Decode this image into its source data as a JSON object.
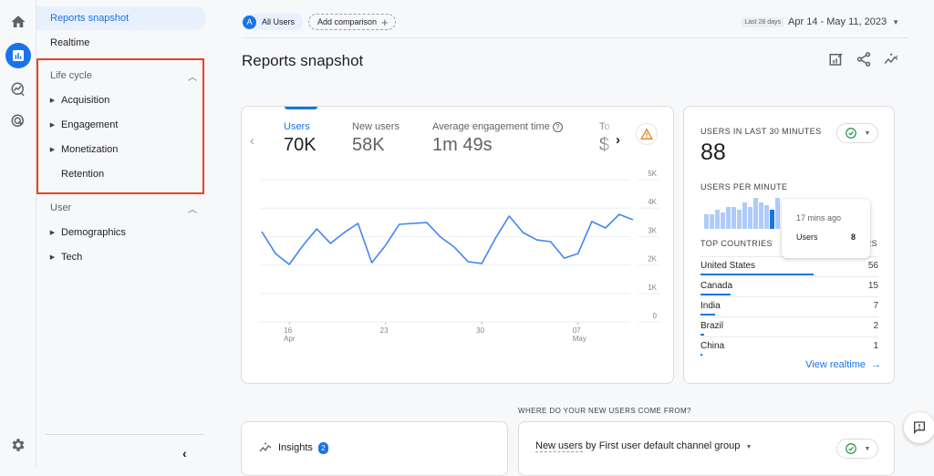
{
  "rail": {
    "icons": [
      "home-icon",
      "reports-icon",
      "explore-icon",
      "advertising-icon",
      "settings-icon"
    ],
    "active": "reports-icon"
  },
  "nav": {
    "reports_snapshot": "Reports snapshot",
    "realtime": "Realtime",
    "lifecycle": {
      "title": "Life cycle",
      "items": [
        {
          "label": "Acquisition",
          "expandable": true
        },
        {
          "label": "Engagement",
          "expandable": true
        },
        {
          "label": "Monetization",
          "expandable": true
        },
        {
          "label": "Retention",
          "expandable": false
        }
      ]
    },
    "user": {
      "title": "User",
      "items": [
        {
          "label": "Demographics",
          "expandable": true
        },
        {
          "label": "Tech",
          "expandable": true
        }
      ]
    },
    "collapse_glyph": "‹"
  },
  "header": {
    "segment_avatar": "A",
    "segment_label": "All Users",
    "add_comparison": "Add comparison",
    "date_badge": "Last 28 days",
    "date_range": "Apr 14 - May 11, 2023",
    "page_title": "Reports snapshot"
  },
  "metrics": [
    {
      "label": "Users",
      "value": "70K",
      "selected": true
    },
    {
      "label": "New users",
      "value": "58K",
      "selected": false
    },
    {
      "label": "Average engagement time",
      "value": "1m 49s",
      "selected": false
    },
    {
      "label": "To",
      "value": "$",
      "selected": false
    }
  ],
  "chart_data": {
    "type": "line",
    "title": "Users",
    "series": [
      {
        "name": "Users",
        "values": [
          3170,
          2400,
          2020,
          2690,
          3270,
          2760,
          3140,
          3460,
          2080,
          2690,
          3430,
          3460,
          3490,
          2980,
          2630,
          2120,
          2050,
          2950,
          3720,
          3140,
          2880,
          2820,
          2240,
          2400,
          3530,
          3300,
          3780,
          3590
        ]
      }
    ],
    "x": [
      "Apr 14",
      "Apr 15",
      "Apr 16",
      "Apr 17",
      "Apr 18",
      "Apr 19",
      "Apr 20",
      "Apr 21",
      "Apr 22",
      "Apr 23",
      "Apr 24",
      "Apr 25",
      "Apr 26",
      "Apr 27",
      "Apr 28",
      "Apr 29",
      "Apr 30",
      "May 1",
      "May 2",
      "May 3",
      "May 4",
      "May 5",
      "May 6",
      "May 7",
      "May 8",
      "May 9",
      "May 10",
      "May 11"
    ],
    "x_ticks": [
      {
        "index": 2,
        "label": "16",
        "sublabel": "Apr"
      },
      {
        "index": 9,
        "label": "23",
        "sublabel": ""
      },
      {
        "index": 16,
        "label": "30",
        "sublabel": ""
      },
      {
        "index": 23,
        "label": "07",
        "sublabel": "May"
      }
    ],
    "y_ticks": [
      "0",
      "1K",
      "2K",
      "3K",
      "4K",
      "5K"
    ],
    "ylim": [
      0,
      5000
    ],
    "grid": true,
    "color": "#4285f4"
  },
  "realtime": {
    "users_caption": "USERS IN LAST 30 MINUTES",
    "users_value": "88",
    "per_minute_caption": "USERS PER MINUTE",
    "per_minute_values": [
      3,
      3,
      4,
      3.5,
      4.5,
      4.5,
      4,
      5.5,
      4.5,
      6.5,
      5.5,
      5,
      4,
      6.5
    ],
    "highlighted_bar_index": 12,
    "tooltip": {
      "time": "17 mins ago",
      "label": "Users",
      "value": "8"
    },
    "top_countries_caption": "TOP COUNTRIES",
    "users_col": "USERS",
    "countries": [
      {
        "name": "United States",
        "value": 56
      },
      {
        "name": "Canada",
        "value": 15
      },
      {
        "name": "India",
        "value": 7
      },
      {
        "name": "Brazil",
        "value": 2
      },
      {
        "name": "China",
        "value": 1
      }
    ],
    "view_link": "View realtime"
  },
  "bottom": {
    "where_caption": "WHERE DO YOUR NEW USERS COME FROM?",
    "insights_label": "Insights",
    "insights_count": "2",
    "newusers_metric": "New users",
    "newusers_rest": " by First user default channel group"
  }
}
